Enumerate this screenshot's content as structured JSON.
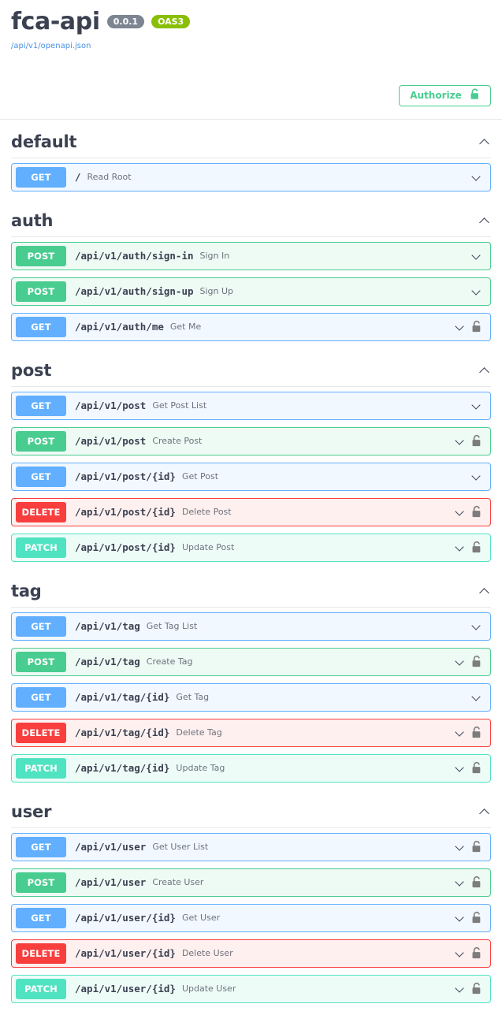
{
  "header": {
    "title": "fca-api",
    "version_badge": "0.0.1",
    "oas_badge": "OAS3",
    "spec_url": "/api/v1/openapi.json",
    "authorize_label": "Authorize",
    "authorize_icon": "unlock-icon"
  },
  "icons": {
    "section_chevron": "chevron-up-icon",
    "row_chevron": "chevron-down-icon",
    "lock": "lock-icon"
  },
  "sections": [
    {
      "tag": "default",
      "expanded": true,
      "operations": [
        {
          "method": "GET",
          "path": "/",
          "summary": "Read Root",
          "locked": false
        }
      ]
    },
    {
      "tag": "auth",
      "expanded": true,
      "operations": [
        {
          "method": "POST",
          "path": "/api/v1/auth/sign-in",
          "summary": "Sign In",
          "locked": false
        },
        {
          "method": "POST",
          "path": "/api/v1/auth/sign-up",
          "summary": "Sign Up",
          "locked": false
        },
        {
          "method": "GET",
          "path": "/api/v1/auth/me",
          "summary": "Get Me",
          "locked": true
        }
      ]
    },
    {
      "tag": "post",
      "expanded": true,
      "operations": [
        {
          "method": "GET",
          "path": "/api/v1/post",
          "summary": "Get Post List",
          "locked": false
        },
        {
          "method": "POST",
          "path": "/api/v1/post",
          "summary": "Create Post",
          "locked": true
        },
        {
          "method": "GET",
          "path": "/api/v1/post/{id}",
          "summary": "Get Post",
          "locked": false
        },
        {
          "method": "DELETE",
          "path": "/api/v1/post/{id}",
          "summary": "Delete Post",
          "locked": true
        },
        {
          "method": "PATCH",
          "path": "/api/v1/post/{id}",
          "summary": "Update Post",
          "locked": true
        }
      ]
    },
    {
      "tag": "tag",
      "expanded": true,
      "operations": [
        {
          "method": "GET",
          "path": "/api/v1/tag",
          "summary": "Get Tag List",
          "locked": false
        },
        {
          "method": "POST",
          "path": "/api/v1/tag",
          "summary": "Create Tag",
          "locked": true
        },
        {
          "method": "GET",
          "path": "/api/v1/tag/{id}",
          "summary": "Get Tag",
          "locked": false
        },
        {
          "method": "DELETE",
          "path": "/api/v1/tag/{id}",
          "summary": "Delete Tag",
          "locked": true
        },
        {
          "method": "PATCH",
          "path": "/api/v1/tag/{id}",
          "summary": "Update Tag",
          "locked": true
        }
      ]
    },
    {
      "tag": "user",
      "expanded": true,
      "operations": [
        {
          "method": "GET",
          "path": "/api/v1/user",
          "summary": "Get User List",
          "locked": true
        },
        {
          "method": "POST",
          "path": "/api/v1/user",
          "summary": "Create User",
          "locked": true
        },
        {
          "method": "GET",
          "path": "/api/v1/user/{id}",
          "summary": "Get User",
          "locked": true
        },
        {
          "method": "DELETE",
          "path": "/api/v1/user/{id}",
          "summary": "Delete User",
          "locked": true
        },
        {
          "method": "PATCH",
          "path": "/api/v1/user/{id}",
          "summary": "Update User",
          "locked": true
        }
      ]
    }
  ],
  "colors": {
    "get": "#61affe",
    "post": "#49cc90",
    "delete": "#f93e3e",
    "patch": "#50e3c2",
    "oas_badge": "#89bf04",
    "version_badge": "#7d8492",
    "link": "#4a90e2",
    "text": "#3b4151"
  }
}
